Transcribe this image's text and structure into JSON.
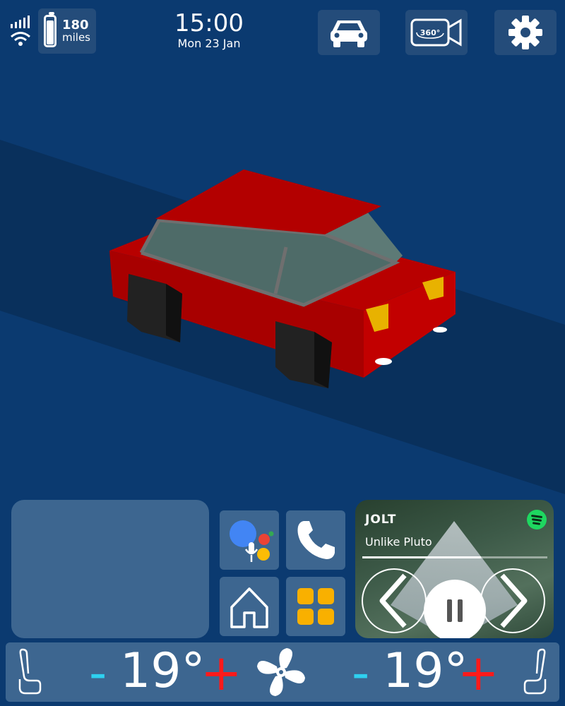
{
  "status": {
    "battery_range_value": "180",
    "battery_range_unit": "miles",
    "battery_level": 0.85
  },
  "clock": {
    "time": "15:00",
    "date": "Mon 23 Jan"
  },
  "top_buttons": {
    "car_icon": "car-icon",
    "camera_icon": "camera-360-icon",
    "camera_label": "360°",
    "settings_icon": "gear-icon"
  },
  "media": {
    "artist": "JOLT",
    "track": "Unlike Pluto",
    "progress": 0.64,
    "service_icon": "spotify-icon"
  },
  "climate": {
    "left_temp": "19°",
    "right_temp": "19°",
    "minus_label": "-",
    "plus_label": "+"
  },
  "colors": {
    "background": "#0b3a70",
    "tile": "#3d6690",
    "minus": "#2ed0f0",
    "plus": "#ff1a1a",
    "car": "#c50000"
  }
}
